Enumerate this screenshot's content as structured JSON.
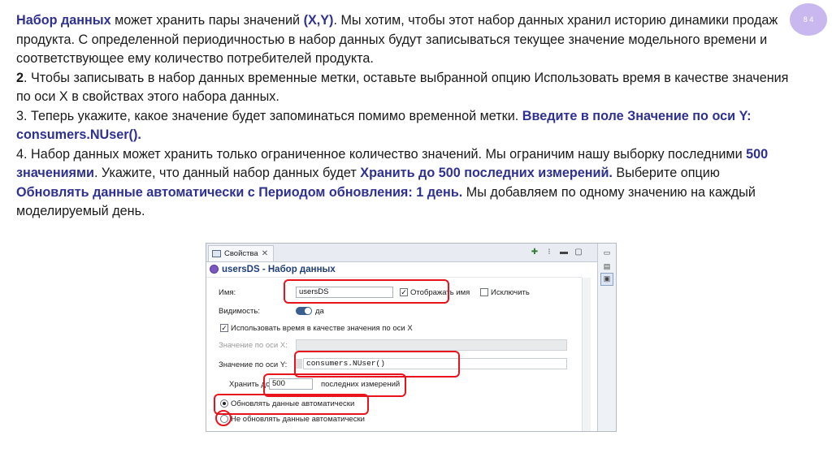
{
  "slide": {
    "page_number": "8 4",
    "paragraphs": [
      [
        {
          "text": "Набор данных",
          "hl": true
        },
        {
          "text": " может хранить пары значений "
        },
        {
          "text": "(X,Y)",
          "hl": true
        },
        {
          "text": ". Мы хотим, чтобы этот набор данных хранил историю динамики продаж продукта. С определенной периодичностью в набор данных будут записываться текущее значение модельного времени и соответствующее ему количество потребителей продукта."
        }
      ],
      [
        {
          "text": "2",
          "bold": true
        },
        {
          "text": ". Чтобы записывать в набор данных временные метки, оставьте выбранной опцию Использовать время в качестве значения по оси X в свойствах этого набора данных."
        }
      ],
      [
        {
          "text": "3. Теперь укажите, какое значение будет запоминаться помимо временной метки. "
        },
        {
          "text": "Введите в поле Значение по оси Y: consumers.NUser().",
          "hl": true
        }
      ],
      [
        {
          "text": "4. Набор данных может хранить только ограниченное количество значений. Мы ограничим нашу выборку последними "
        },
        {
          "text": "500 значениями",
          "hl": true
        },
        {
          "text": ". Укажите, что данный набор данных будет "
        },
        {
          "text": "Хранить до 500 последних измерений.",
          "hl": true
        },
        {
          "text": " Выберите опцию "
        },
        {
          "text": "Обновлять данные автоматически с Периодом обновления: 1 день.",
          "hl": true
        },
        {
          "text": " Мы добавляем по одному значению на каждый моделируемый день."
        }
      ]
    ]
  },
  "panel": {
    "tab_label": "Свойства",
    "tab_close": "✕",
    "title": "usersDS - Набор данных",
    "name_label": "Имя:",
    "name_value": "usersDS",
    "show_name_label": "Отображать имя",
    "exclude_label": "Исключить",
    "visibility_label": "Видимость:",
    "visibility_value": "да",
    "use_time_label": "Использовать время в качестве значения по оси X",
    "x_value_label": "Значение по оси X:",
    "y_value_label": "Значение по оси Y:",
    "y_value": "consumers.NUser()",
    "keep_label": "Хранить до",
    "keep_value": "500",
    "keep_suffix": "последних измерений",
    "auto_update_label": "Обновлять данные автоматически",
    "no_auto_update_label": "Не обновлять данные автоматически",
    "icons": [
      "properties-tab-icon",
      "new-window-icon",
      "more-icon",
      "minimize-icon",
      "maximize-icon",
      "dataset-icon",
      "palette-icon"
    ]
  }
}
